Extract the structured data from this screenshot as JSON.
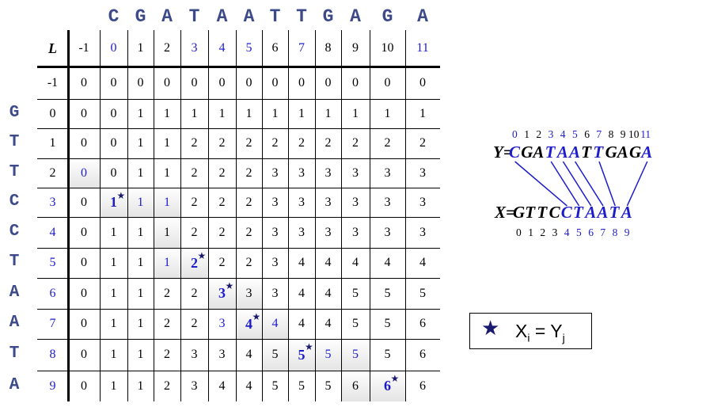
{
  "seq_y": [
    "C",
    "G",
    "A",
    "T",
    "A",
    "A",
    "T",
    "T",
    "G",
    "A",
    "G",
    "A"
  ],
  "seq_x": [
    "G",
    "T",
    "T",
    "C",
    "C",
    "T",
    "A",
    "A",
    "T",
    "A"
  ],
  "table": {
    "corner_label": "L",
    "col_headers": [
      "-1",
      "0",
      "1",
      "2",
      "3",
      "4",
      "5",
      "6",
      "7",
      "8",
      "9",
      "10",
      "11"
    ],
    "row_headers": [
      "-1",
      "0",
      "1",
      "2",
      "3",
      "4",
      "5",
      "6",
      "7",
      "8",
      "9"
    ],
    "rows": [
      [
        "0",
        "0",
        "0",
        "0",
        "0",
        "0",
        "0",
        "0",
        "0",
        "0",
        "0",
        "0",
        "0"
      ],
      [
        "0",
        "0",
        "1",
        "1",
        "1",
        "1",
        "1",
        "1",
        "1",
        "1",
        "1",
        "1",
        "1"
      ],
      [
        "0",
        "0",
        "1",
        "1",
        "2",
        "2",
        "2",
        "2",
        "2",
        "2",
        "2",
        "2",
        "2"
      ],
      [
        "0",
        "0",
        "1",
        "1",
        "2",
        "2",
        "2",
        "3",
        "3",
        "3",
        "3",
        "3",
        "3"
      ],
      [
        "0",
        "1",
        "1",
        "1",
        "2",
        "2",
        "2",
        "3",
        "3",
        "3",
        "3",
        "3",
        "3"
      ],
      [
        "0",
        "1",
        "1",
        "1",
        "2",
        "2",
        "2",
        "3",
        "3",
        "3",
        "3",
        "3",
        "3"
      ],
      [
        "0",
        "1",
        "1",
        "1",
        "2",
        "2",
        "2",
        "3",
        "4",
        "4",
        "4",
        "4",
        "4"
      ],
      [
        "0",
        "1",
        "1",
        "2",
        "2",
        "3",
        "3",
        "3",
        "4",
        "4",
        "5",
        "5",
        "5"
      ],
      [
        "0",
        "1",
        "1",
        "2",
        "2",
        "3",
        "4",
        "4",
        "4",
        "4",
        "5",
        "5",
        "6"
      ],
      [
        "0",
        "1",
        "1",
        "2",
        "3",
        "3",
        "4",
        "5",
        "5",
        "5",
        "5",
        "5",
        "6"
      ],
      [
        "0",
        "1",
        "1",
        "2",
        "3",
        "4",
        "4",
        "5",
        "5",
        "5",
        "6",
        "6",
        "6"
      ]
    ],
    "blue_col_headers": [
      "0",
      "3",
      "4",
      "5",
      "7",
      "11"
    ],
    "blue_row_headers": [
      "3",
      "4",
      "5",
      "6",
      "7",
      "8",
      "9"
    ],
    "blue_cells": [
      [
        4,
        1
      ],
      [
        5,
        2
      ],
      [
        5,
        3
      ],
      [
        5,
        4
      ],
      [
        7,
        5
      ],
      [
        8,
        6
      ],
      [
        9,
        7
      ],
      [
        9,
        8
      ],
      [
        10,
        9
      ],
      [
        10,
        10
      ],
      [
        10,
        11
      ],
      [
        11,
        12
      ],
      [
        7,
        4
      ],
      [
        9,
        6
      ]
    ],
    "star_cells": [
      [
        5,
        2
      ],
      [
        7,
        5
      ],
      [
        8,
        6
      ],
      [
        9,
        7
      ],
      [
        10,
        9
      ],
      [
        11,
        12
      ]
    ],
    "shaded_cells": [
      [
        4,
        1
      ],
      [
        5,
        2
      ],
      [
        5,
        3
      ],
      [
        5,
        4
      ],
      [
        6,
        4
      ],
      [
        7,
        4
      ],
      [
        7,
        5
      ],
      [
        8,
        6
      ],
      [
        8,
        7
      ],
      [
        9,
        7
      ],
      [
        9,
        8
      ],
      [
        10,
        8
      ],
      [
        10,
        9
      ],
      [
        10,
        10
      ],
      [
        10,
        11
      ],
      [
        11,
        11
      ],
      [
        11,
        12
      ]
    ]
  },
  "alignment": {
    "y_label": "Y=",
    "y_sequence": "CGATAATTGAGA",
    "y_indices": [
      "0",
      "1",
      "2",
      "3",
      "4",
      "5",
      "6",
      "7",
      "8",
      "9",
      "10",
      "11"
    ],
    "y_highlight": [
      0,
      3,
      4,
      5,
      7,
      11
    ],
    "x_label": "X=",
    "x_sequence": "GTTCCTAATA",
    "x_indices": [
      "0",
      "1",
      "2",
      "3",
      "4",
      "5",
      "6",
      "7",
      "8",
      "9"
    ],
    "x_highlight": [
      4,
      5,
      6,
      7,
      8,
      9
    ],
    "links": [
      [
        4,
        0
      ],
      [
        5,
        3
      ],
      [
        6,
        4
      ],
      [
        7,
        5
      ],
      [
        8,
        7
      ],
      [
        9,
        11
      ]
    ]
  },
  "legend": {
    "symbol": "★",
    "text_x": "X",
    "sub_i": "i",
    "equals": " = ",
    "text_y": "Y",
    "sub_j": "j"
  },
  "colors": {
    "blue": "#1d1dcc",
    "letter": "#3c4a8a",
    "star": "#1a1a6e"
  }
}
